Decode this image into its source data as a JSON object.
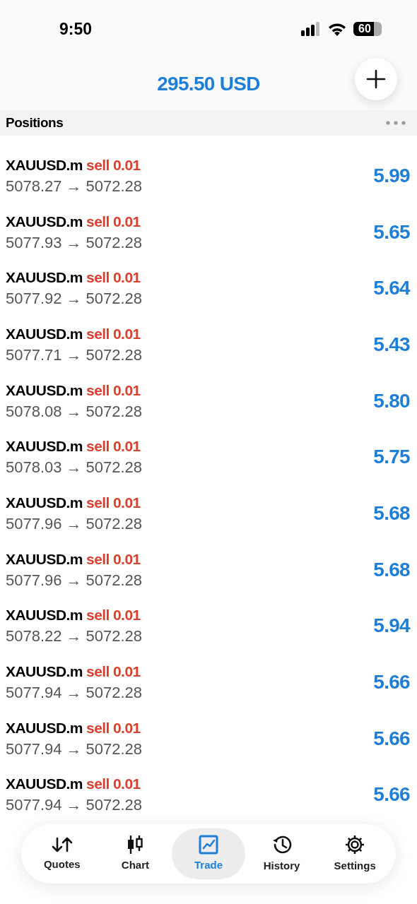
{
  "status_bar": {
    "time": "9:50",
    "battery": "60"
  },
  "header": {
    "balance": "295.50 USD"
  },
  "section": {
    "title": "Positions"
  },
  "positions": [
    {
      "symbol": "XAUUSD.m",
      "side": "sell",
      "volume": "0.01",
      "open_price": "5078.27",
      "current_price": "5072.28",
      "arrow": "→",
      "profit": "5.99"
    },
    {
      "symbol": "XAUUSD.m",
      "side": "sell",
      "volume": "0.01",
      "open_price": "5077.93",
      "current_price": "5072.28",
      "arrow": "→",
      "profit": "5.65"
    },
    {
      "symbol": "XAUUSD.m",
      "side": "sell",
      "volume": "0.01",
      "open_price": "5077.92",
      "current_price": "5072.28",
      "arrow": "→",
      "profit": "5.64"
    },
    {
      "symbol": "XAUUSD.m",
      "side": "sell",
      "volume": "0.01",
      "open_price": "5077.71",
      "current_price": "5072.28",
      "arrow": "→",
      "profit": "5.43"
    },
    {
      "symbol": "XAUUSD.m",
      "side": "sell",
      "volume": "0.01",
      "open_price": "5078.08",
      "current_price": "5072.28",
      "arrow": "→",
      "profit": "5.80"
    },
    {
      "symbol": "XAUUSD.m",
      "side": "sell",
      "volume": "0.01",
      "open_price": "5078.03",
      "current_price": "5072.28",
      "arrow": "→",
      "profit": "5.75"
    },
    {
      "symbol": "XAUUSD.m",
      "side": "sell",
      "volume": "0.01",
      "open_price": "5077.96",
      "current_price": "5072.28",
      "arrow": "→",
      "profit": "5.68"
    },
    {
      "symbol": "XAUUSD.m",
      "side": "sell",
      "volume": "0.01",
      "open_price": "5077.96",
      "current_price": "5072.28",
      "arrow": "→",
      "profit": "5.68"
    },
    {
      "symbol": "XAUUSD.m",
      "side": "sell",
      "volume": "0.01",
      "open_price": "5078.22",
      "current_price": "5072.28",
      "arrow": "→",
      "profit": "5.94"
    },
    {
      "symbol": "XAUUSD.m",
      "side": "sell",
      "volume": "0.01",
      "open_price": "5077.94",
      "current_price": "5072.28",
      "arrow": "→",
      "profit": "5.66"
    },
    {
      "symbol": "XAUUSD.m",
      "side": "sell",
      "volume": "0.01",
      "open_price": "5077.94",
      "current_price": "5072.28",
      "arrow": "→",
      "profit": "5.66"
    },
    {
      "symbol": "XAUUSD.m",
      "side": "sell",
      "volume": "0.01",
      "open_price": "5077.94",
      "current_price": "5072.28",
      "arrow": "→",
      "profit": "5.66"
    }
  ],
  "tabs": [
    {
      "kind": "quotes",
      "label": "Quotes",
      "selected": false
    },
    {
      "kind": "chart",
      "label": "Chart",
      "selected": false
    },
    {
      "kind": "trade",
      "label": "Trade",
      "selected": true
    },
    {
      "kind": "history",
      "label": "History",
      "selected": false
    },
    {
      "kind": "settings",
      "label": "Settings",
      "selected": false
    }
  ]
}
